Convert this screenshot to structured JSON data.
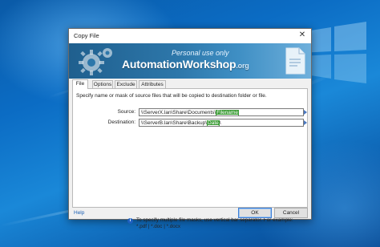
{
  "window": {
    "title": "Copy File",
    "close_symbol": "✕"
  },
  "banner": {
    "personal_use": "Personal use only",
    "brand": "AutomationWorkshop",
    "brand_suffix": ".org"
  },
  "tabs": [
    {
      "label": "File",
      "active": true
    },
    {
      "label": "Options",
      "active": false
    },
    {
      "label": "Exclude",
      "active": false
    },
    {
      "label": "Attributes",
      "active": false
    }
  ],
  "form": {
    "hint": "Specify name or mask of source files that will be copied to destination folder or file.",
    "source": {
      "label": "Source:",
      "prefix": "\\\\ServerX.lan\\Share\\Documents\\",
      "tag": "Filename",
      "suffix": ""
    },
    "destination": {
      "label": "Destination:",
      "prefix": "\\\\ServerB.lan\\Share\\Backup\\",
      "tag": "Date",
      "suffix": "\\"
    }
  },
  "info": {
    "line1": "To specify multiple file masks, use vertical bar separator. For example:",
    "line2": "*.pdf | *.doc | *.docx"
  },
  "footer": {
    "help": "Help",
    "ok": "OK",
    "cancel": "Cancel"
  },
  "colors": {
    "tag_green": "#3c9c36",
    "accent_blue": "#1a5fb4",
    "desktop_blue": "#0b6cc4"
  }
}
